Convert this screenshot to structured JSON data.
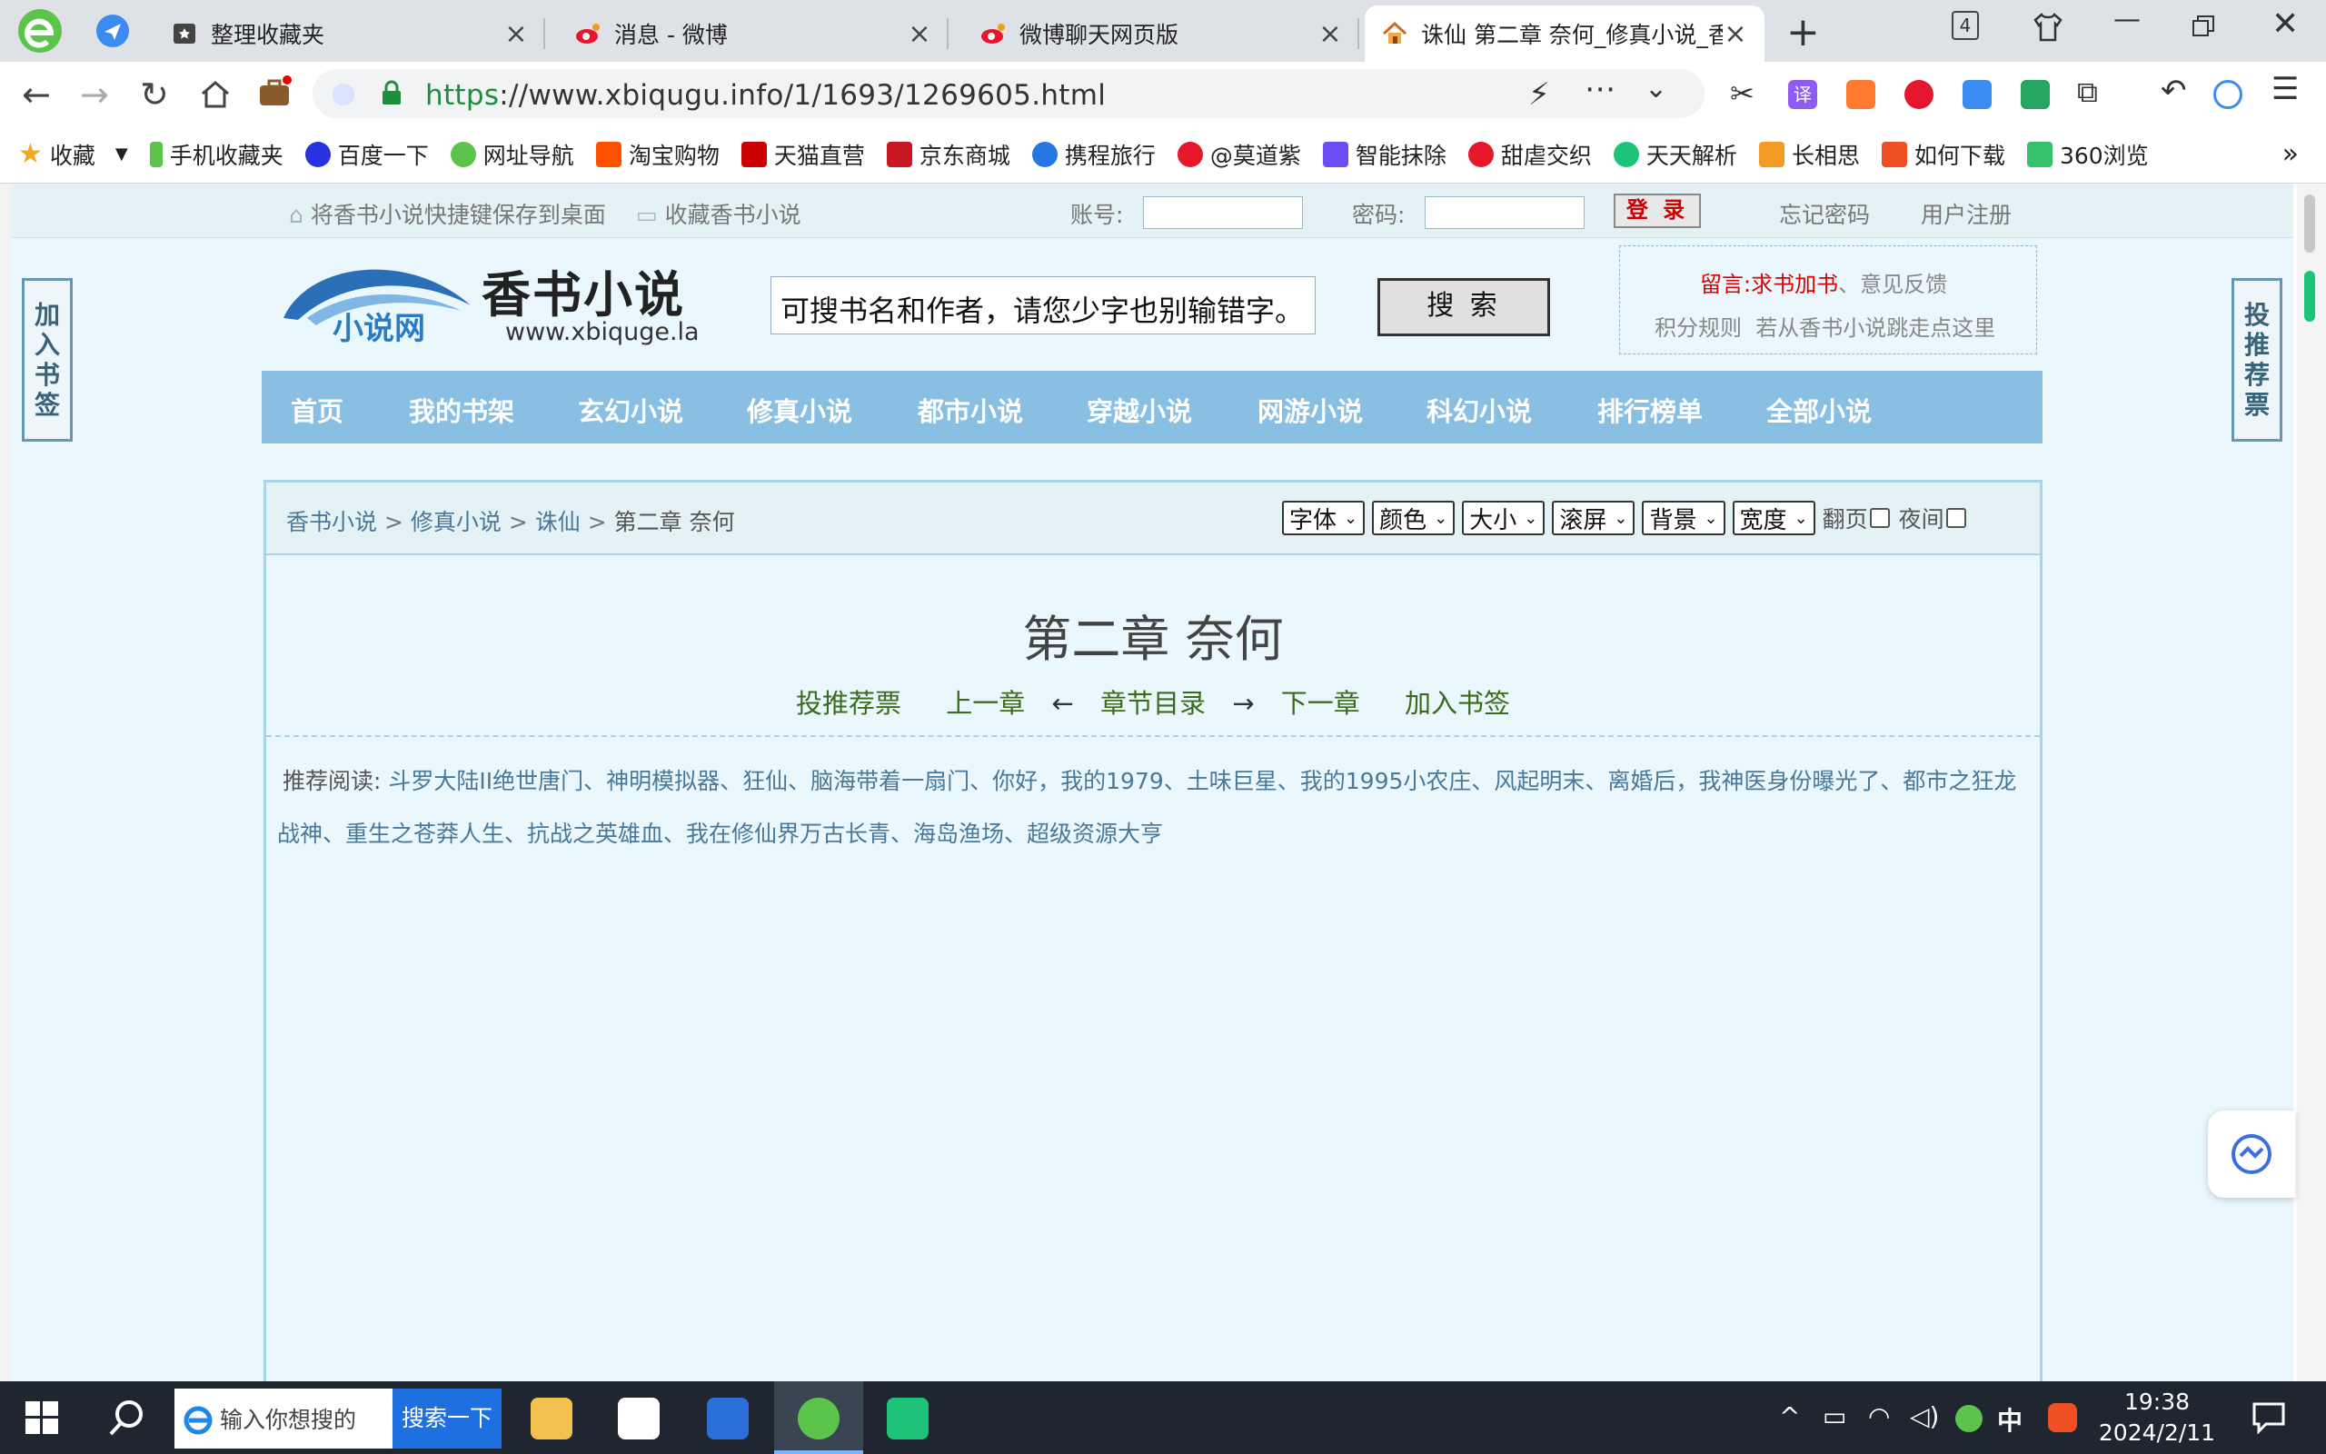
{
  "browser": {
    "tabs": [
      {
        "title": "整理收藏夹",
        "active": false
      },
      {
        "title": "消息 - 微博",
        "active": false
      },
      {
        "title": "微博聊天网页版",
        "active": false
      },
      {
        "title": "诛仙 第二章 奈何_修真小说_香",
        "active": true
      }
    ],
    "new_tab": "+",
    "tab_count": "4",
    "url_scheme": "https",
    "url_rest": "://www.xbiqugu.info/1/1693/1269605.html",
    "bookmarks": [
      "收藏",
      "手机收藏夹",
      "百度一下",
      "网址导航",
      "淘宝购物",
      "天猫直营",
      "京东商城",
      "携程旅行",
      "@莫道紫",
      "智能抹除",
      "甜虐交织",
      "天天解析",
      "长相思",
      "如何下载",
      "360浏览"
    ],
    "bookmarks_more": "»"
  },
  "site": {
    "topbar": {
      "save_shortcut": "将香书小说快捷键保存到桌面",
      "favorite": "收藏香书小说",
      "account_label": "账号:",
      "password_label": "密码:",
      "login": "登 录",
      "forgot": "忘记密码",
      "register": "用户注册"
    },
    "side_left": "加入书签",
    "side_right": "投推荐票",
    "logo_name": "香书小说",
    "logo_domain": "www.xbiquge.la",
    "logo_sub": "小说网",
    "search_placeholder": "可搜书名和作者，请您少字也别输错字。",
    "search_button": "搜 索",
    "notice": {
      "prefix": "留言:",
      "request": "求书加书",
      "sep": "、",
      "feedback": "意见反馈",
      "rules": "积分规则",
      "jump": "若从香书小说跳走点这里"
    },
    "nav": [
      "首页",
      "我的书架",
      "玄幻小说",
      "修真小说",
      "都市小说",
      "穿越小说",
      "网游小说",
      "科幻小说",
      "排行榜单",
      "全部小说"
    ],
    "breadcrumb": {
      "home": "香书小说",
      "category": "修真小说",
      "book": "诛仙",
      "chapter": "第二章 奈何",
      "sep": ">"
    },
    "controls": {
      "font": "字体",
      "color": "颜色",
      "size": "大小",
      "scroll": "滚屏",
      "background": "背景",
      "width": "宽度",
      "page_turn": "翻页",
      "night": "夜间"
    },
    "chapter_title": "第二章 奈何",
    "chapter_nav": {
      "vote": "投推荐票",
      "prev": "上一章",
      "left_arrow": "←",
      "toc": "章节目录",
      "right_arrow": "→",
      "next": "下一章",
      "bookmark": "加入书签"
    },
    "recommend_label": "推荐阅读:",
    "recommend": "斗罗大陆II绝世唐门、神明模拟器、狂仙、脑海带着一扇门、你好，我的1979、土味巨星、我的1995小农庄、风起明末、离婚后，我神医身份曝光了、都市之狂龙战神、重生之苍莽人生、抗战之英雄血、我在修仙界万古长青、海岛渔场、超级资源大亨"
  },
  "taskbar": {
    "search_placeholder": "输入你想搜的",
    "search_button": "搜索一下",
    "ime": "中",
    "time": "19:38",
    "date": "2024/2/11"
  }
}
